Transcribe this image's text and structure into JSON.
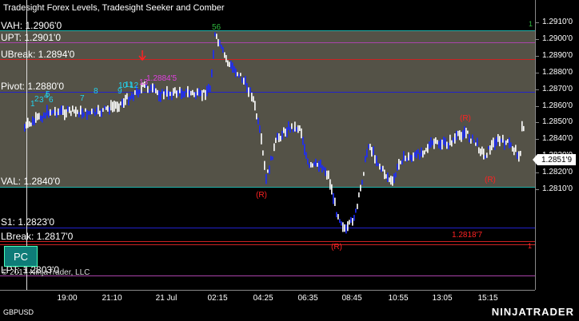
{
  "window": {
    "title": "Tradesight Forex Levels, Tradesight Seeker and Comber",
    "symbol": "GBPUSD",
    "brand": "NINJATRADER"
  },
  "levels": {
    "vah": "VAH: 1.2906'0",
    "upt": "UPT: 1.2901'0",
    "ubreak": "UBreak: 1.2894'0",
    "pivot": "Pivot: 1.2880'0",
    "val": "VAL: 1.2840'0",
    "s1": "S1: 1.2823'0",
    "lbreak": "LBreak: 1.2817'0",
    "lpt": "LPT: 1.2803'0"
  },
  "yaxis": {
    "ticks": [
      "1.2910'0",
      "1.2900'0",
      "1.2890'0",
      "1.2880'0",
      "1.2870'0",
      "1.2860'0",
      "1.2850'0",
      "1.2840'0",
      "1.2830'0",
      "1.2820'0",
      "1.2810'0"
    ]
  },
  "xaxis": {
    "ticks": [
      "19:00",
      "21:10",
      "21 Jul",
      "02:15",
      "04:25",
      "06:35",
      "08:45",
      "10:55",
      "13:05",
      "15:15"
    ]
  },
  "last_price": "1.2851'9",
  "pc_button": "PC",
  "copyright": "© 2017 NinjaTrader, LLC",
  "annotations": {
    "seeker_high": "1.2884'5",
    "seeker_low": "1.2818'7",
    "count_56": "56",
    "r_labels": [
      "(R)",
      "(R)",
      "(R)",
      "(R)"
    ],
    "count_nums": [
      "1",
      "2",
      "3",
      "4",
      "5",
      "6",
      "7",
      "8",
      "9",
      "10",
      "11",
      "12",
      "13"
    ],
    "one_top": "1",
    "one_bot": "1"
  },
  "colors": {
    "value_area": "#545247",
    "vah": "#20b2aa",
    "upt": "#aa44aa",
    "ubreak": "#cc2222",
    "pivot": "#2222cc",
    "val": "#20b2aa",
    "s1": "#2222cc",
    "lbreak": "#cc2222",
    "lpt": "#aa44aa",
    "up_bar": "#ffffff",
    "down_bar": "#1c2cff"
  }
}
